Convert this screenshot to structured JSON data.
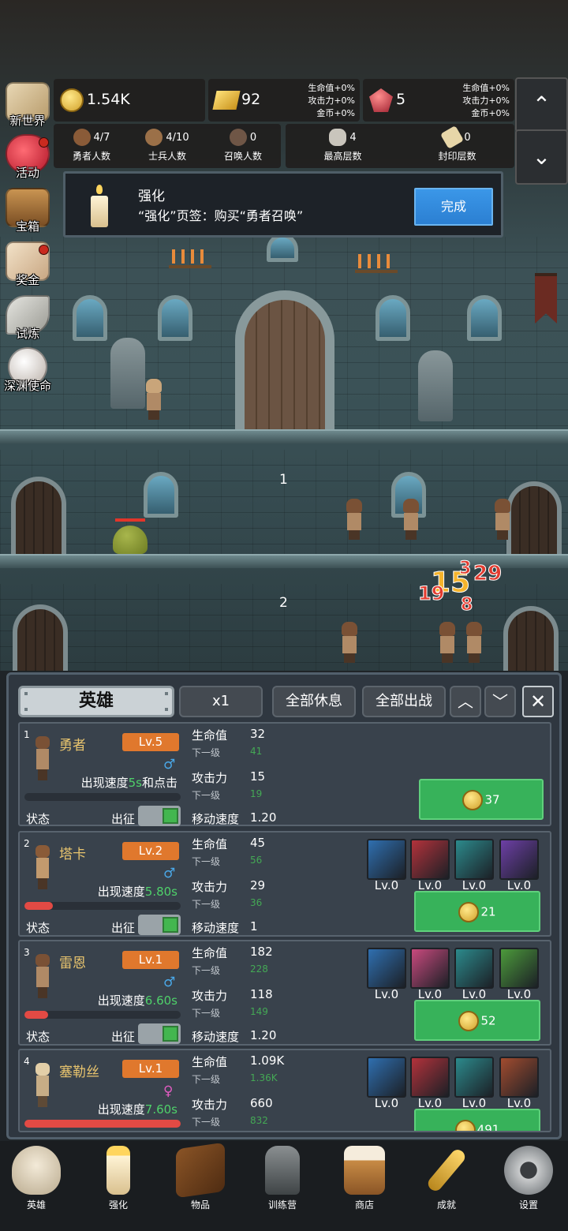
{
  "side_menu": [
    {
      "label": "新世界",
      "dot": false
    },
    {
      "label": "活动",
      "dot": true
    },
    {
      "label": "宝箱",
      "dot": false
    },
    {
      "label": "奖金",
      "dot": true
    },
    {
      "label": "试炼",
      "dot": false
    },
    {
      "label": "深渊使命",
      "dot": false
    }
  ],
  "resources": {
    "gold": {
      "value": "1.54K"
    },
    "bar": {
      "value": "92",
      "bonus": [
        "生命值+0%",
        "攻击力+0%",
        "金币+0%"
      ]
    },
    "ruby": {
      "value": "5",
      "bonus": [
        "生命值+0%",
        "攻击力+0%",
        "金币+0%"
      ]
    }
  },
  "stats": {
    "heroes": {
      "value": "4/7",
      "label": "勇者人数"
    },
    "soldiers": {
      "value": "4/10",
      "label": "士兵人数"
    },
    "summons": {
      "value": "0",
      "label": "召唤人数"
    },
    "max_floor": {
      "value": "4",
      "label": "最高层数"
    },
    "sealed_floor": {
      "value": "0",
      "label": "封印层数"
    }
  },
  "scroll": {
    "up": "⌃",
    "down": "⌄"
  },
  "quest": {
    "title": "强化",
    "desc": "“强化”页签：购买“勇者召唤”",
    "button": "完成"
  },
  "scene": {
    "floor_labels": [
      "1",
      "2"
    ],
    "damage_numbers": [
      "15",
      "29",
      "19",
      "3",
      "8"
    ]
  },
  "panel": {
    "tabs": {
      "hero": "英雄",
      "speed": "x1",
      "rest_all": "全部休息",
      "deploy_all": "全部出战"
    },
    "close": "✕",
    "arrow_up": "︿",
    "arrow_down": "﹀"
  },
  "labels": {
    "hp": "生命值",
    "next": "下一级",
    "atk": "攻击力",
    "move": "移动速度",
    "state": "状态",
    "deploy": "出征",
    "speed_prefix": "出现速度"
  },
  "heroes": [
    {
      "idx": "1",
      "name": "勇者",
      "level": "Lv.5",
      "gender": "♂",
      "speed": "5s",
      "speed_suffix": "和点击",
      "hp": "32",
      "hp_next": "41",
      "atk": "15",
      "atk_next": "19",
      "move": "1.20",
      "hp_fill": 0,
      "price": "37",
      "equip": []
    },
    {
      "idx": "2",
      "name": "塔卡",
      "level": "Lv.2",
      "gender": "♂",
      "speed": "5.80s",
      "speed_suffix": "",
      "hp": "45",
      "hp_next": "56",
      "atk": "29",
      "atk_next": "36",
      "move": "1",
      "hp_fill": 0.18,
      "price": "21",
      "equip": [
        {
          "icon": "axe-shield-icon",
          "lv": "Lv.0",
          "color": "#2f6fb0"
        },
        {
          "icon": "double-axe-icon",
          "lv": "Lv.0",
          "color": "#b3323b"
        },
        {
          "icon": "iron-boots-icon",
          "lv": "Lv.0",
          "color": "#2c8a8c"
        },
        {
          "icon": "hammer-icon",
          "lv": "Lv.0",
          "color": "#6d3fa6"
        }
      ]
    },
    {
      "idx": "3",
      "name": "雷恩",
      "level": "Lv.1",
      "gender": "♂",
      "speed": "6.60s",
      "speed_suffix": "",
      "hp": "182",
      "hp_next": "228",
      "atk": "118",
      "atk_next": "149",
      "move": "1.20",
      "hp_fill": 0.15,
      "price": "52",
      "equip": [
        {
          "icon": "sword-icon",
          "lv": "Lv.0",
          "color": "#2f6fb0"
        },
        {
          "icon": "blade-icon",
          "lv": "Lv.0",
          "color": "#c94a7e"
        },
        {
          "icon": "leather-boots-icon",
          "lv": "Lv.0",
          "color": "#2c8a8c"
        },
        {
          "icon": "lizard-icon",
          "lv": "Lv.0",
          "color": "#4c9a3b"
        }
      ]
    },
    {
      "idx": "4",
      "name": "塞勒丝",
      "level": "Lv.1",
      "gender": "♀",
      "speed": "7.60s",
      "speed_suffix": "",
      "hp": "1.09K",
      "hp_next": "1.36K",
      "atk": "660",
      "atk_next": "832",
      "move": "",
      "hp_fill": 1.0,
      "price": "491",
      "equip": [
        {
          "icon": "star-shield-icon",
          "lv": "Lv.0",
          "color": "#2f6fb0"
        },
        {
          "icon": "monster-icon",
          "lv": "Lv.0",
          "color": "#b3323b"
        },
        {
          "icon": "armored-boots-icon",
          "lv": "Lv.0",
          "color": "#2c8a8c"
        },
        {
          "icon": "bat-icon",
          "lv": "Lv.0",
          "color": "#a24c2f"
        }
      ]
    }
  ],
  "bottom_nav": [
    {
      "label": "英雄",
      "icon": "skull-icon"
    },
    {
      "label": "强化",
      "icon": "candle-icon"
    },
    {
      "label": "物品",
      "icon": "book-icon"
    },
    {
      "label": "训练营",
      "icon": "lantern-icon"
    },
    {
      "label": "商店",
      "icon": "beer-mug-icon"
    },
    {
      "label": "成就",
      "icon": "key-icon"
    },
    {
      "label": "设置",
      "icon": "gear-icon"
    }
  ],
  "colors": {
    "level_badge": "#e0782d",
    "buy_green": "#37b25a",
    "speed_green": "#4fd16a",
    "quest_button": "#2b7fd2"
  }
}
